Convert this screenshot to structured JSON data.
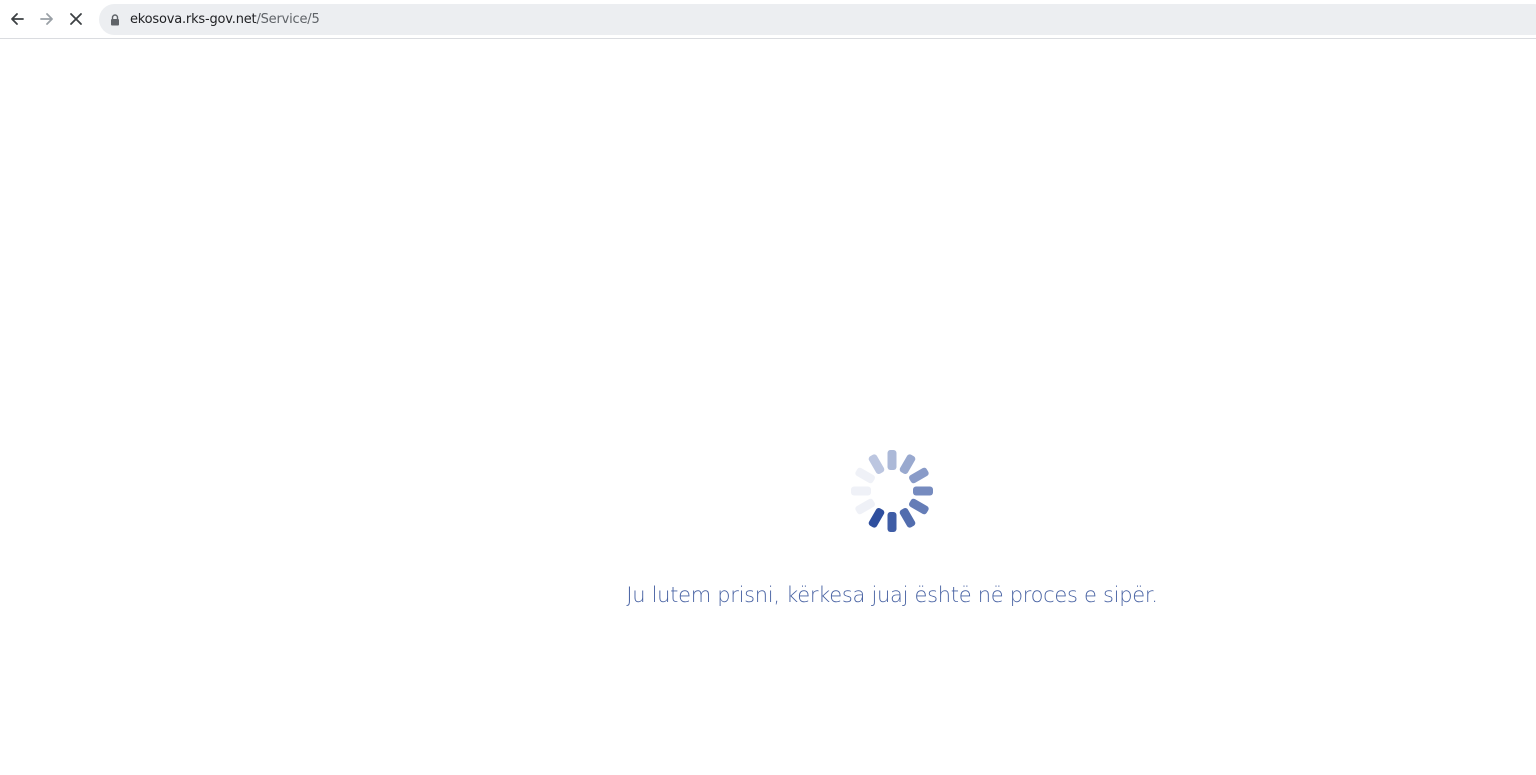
{
  "browser": {
    "url_host": "ekosova.rks-gov.net",
    "url_path": "/Service/5",
    "icons": {
      "back": "arrow-left-icon",
      "forward": "arrow-right-icon",
      "stop": "close-icon",
      "lock": "lock-icon"
    }
  },
  "page": {
    "loading_message": "Ju lutem prisni, kërkesa juaj është në proces e sipër.",
    "spinner_color": "#2f4f9e",
    "text_color": "#4a64a4"
  }
}
